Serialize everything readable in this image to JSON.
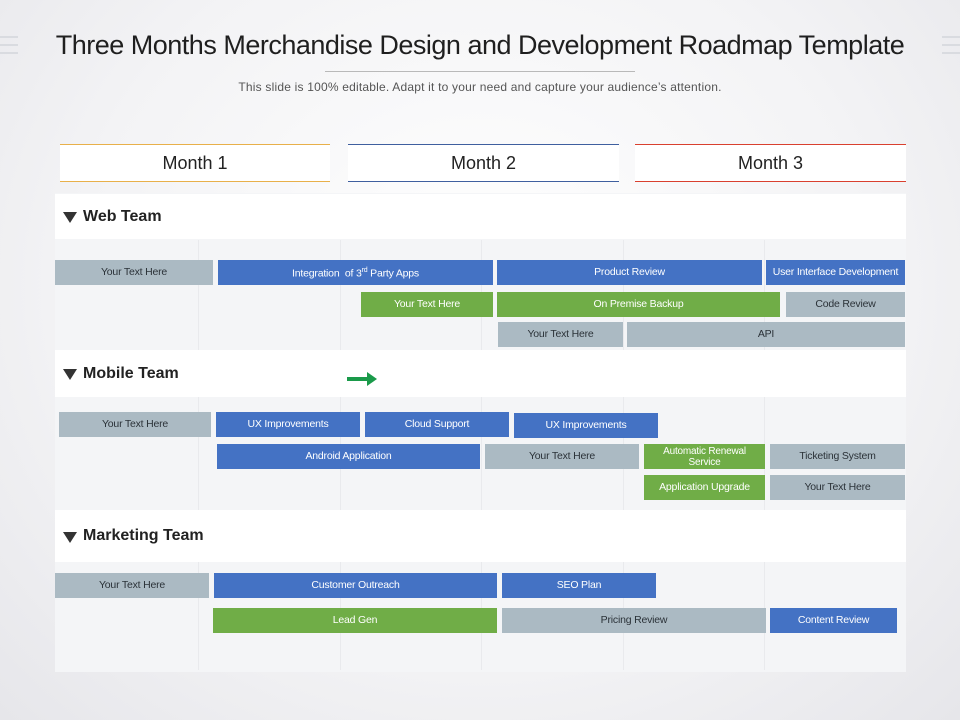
{
  "title": "Three Months Merchandise Design and Development Roadmap Template",
  "subtitle": "This slide is 100% editable. Adapt it to your need and capture your audience’s attention.",
  "months": [
    {
      "label": "Month 1",
      "color": "#e8b04a"
    },
    {
      "label": "Month 2",
      "color": "#3f5f9f"
    },
    {
      "label": "Month 3",
      "color": "#d9402f"
    }
  ],
  "sections": {
    "web": "Web Team",
    "mobile": "Mobile Team",
    "marketing": "Marketing Team"
  },
  "colors": {
    "blue": "#4472c4",
    "green": "#70ad47",
    "gray": "#abbac3"
  },
  "bars": {
    "web": {
      "r1": [
        "Your Text Here",
        "Integration of 3rd Party Apps",
        "Product Review",
        "User Interface Development"
      ],
      "r2": [
        "Your Text Here",
        "On Premise Backup",
        "Code Review"
      ],
      "r3": [
        "Your Text Here",
        "API"
      ]
    },
    "mobile": {
      "r1": [
        "Your Text Here",
        "UX Improvements",
        "Cloud Support",
        "UX Improvements"
      ],
      "r2": [
        "Android Application",
        "Your Text Here",
        "Automatic Renewal Service",
        "Ticketing System"
      ],
      "r3": [
        "Application Upgrade",
        "Your Text Here"
      ]
    },
    "marketing": {
      "r1": [
        "Your Text Here",
        "Customer Outreach",
        "SEO Plan"
      ],
      "r2": [
        "Lead Gen",
        "Pricing Review",
        "Content Review"
      ]
    }
  },
  "icons": {
    "section_toggle": "triangle-down-icon",
    "arrow": "arrow-right-icon"
  }
}
